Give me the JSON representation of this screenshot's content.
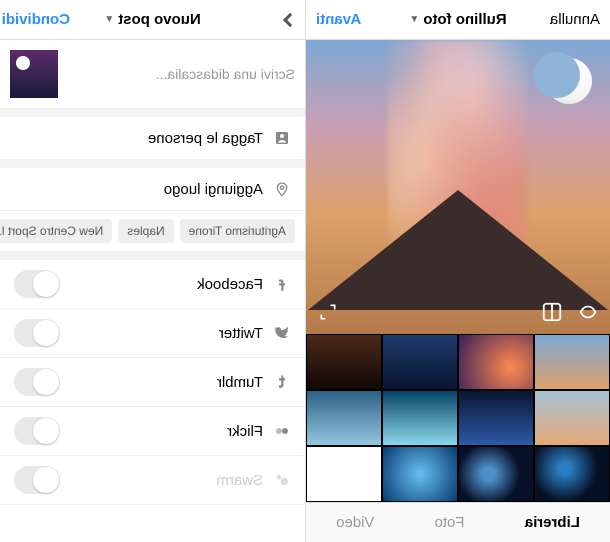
{
  "left": {
    "header": {
      "cancel": "Annulla",
      "title": "Rullino foto",
      "next": "Avanti"
    },
    "tabs": {
      "library": "Libreria",
      "photo": "Foto",
      "video": "Video"
    }
  },
  "right": {
    "header": {
      "title": "Nuovo post",
      "share": "Condividi"
    },
    "caption_placeholder": "Scrivi una didascalia...",
    "tag_people": "Tagga le persone",
    "add_location": "Aggiungi luogo",
    "chips": [
      "Agriturismo Tirone",
      "Naples",
      "New Centro Sport l..."
    ],
    "socials": {
      "facebook": "Facebook",
      "twitter": "Twitter",
      "tumblr": "Tumblr",
      "flickr": "Flickr",
      "swarm": "Swarm"
    }
  }
}
